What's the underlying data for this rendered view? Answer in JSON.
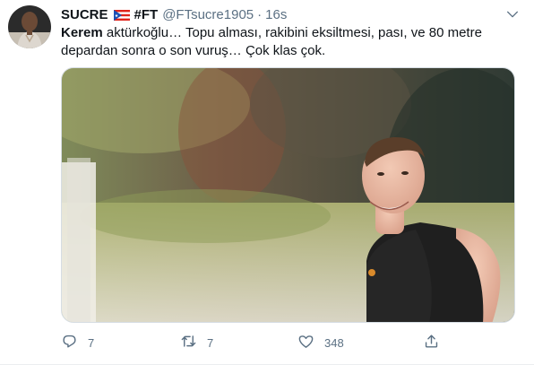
{
  "tweet": {
    "author": {
      "display_name": "SUCRE",
      "flag": "Puerto Rico flag",
      "name_suffix": "#FT",
      "handle": "@FTsucre1905",
      "avatar_icon": "avatar"
    },
    "separator": "·",
    "time": "16s",
    "text": {
      "bold": "Kerem",
      "rest": " aktürkoğlu… Topu alması, rakibini eksiltmesi, pası, ve 80 metre depardan sonra o son vuruş… Çok klas çok."
    },
    "actions": {
      "reply_count": "7",
      "retweet_count": "7",
      "like_count": "348",
      "share_count": ""
    }
  },
  "colors": {
    "text": "#0f1419",
    "secondary": "#5b7083",
    "border": "#ebeef0",
    "media_border": "#d6dde3"
  },
  "icons": [
    "caret-down-icon",
    "reply-icon",
    "retweet-icon",
    "like-icon",
    "share-icon"
  ]
}
